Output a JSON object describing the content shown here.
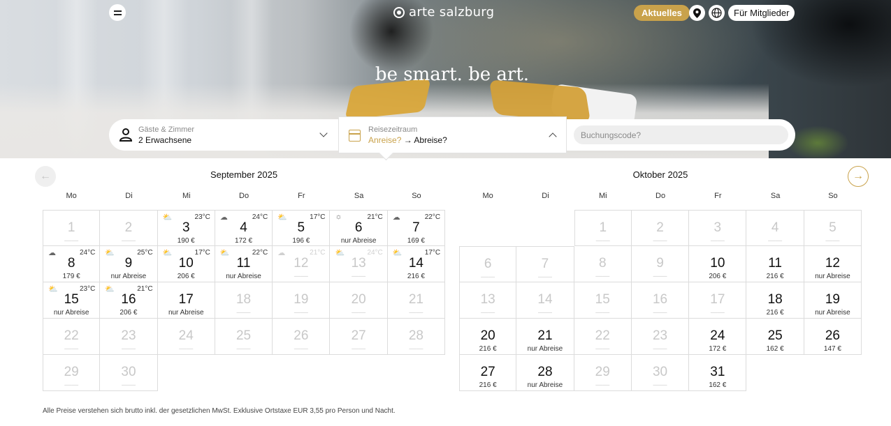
{
  "header": {
    "brand": "arte salzburg",
    "aktuelles_label": "Aktuelles",
    "members_label": "Für Mitglieder",
    "tagline": "be smart. be art."
  },
  "search": {
    "guests_label": "Gäste & Zimmer",
    "guests_value": "2 Erwachsene",
    "dates_label": "Reisezeitraum",
    "arrival": "Anreise?",
    "arrow": "→",
    "departure": "Abreise?",
    "code_placeholder": "Buchungscode?"
  },
  "colors": {
    "accent": "#c9a24b"
  },
  "weekdays": [
    "Mo",
    "Di",
    "Mi",
    "Do",
    "Fr",
    "Sa",
    "So"
  ],
  "months": [
    {
      "title": "September 2025",
      "offset": 0,
      "days": [
        {
          "d": "1",
          "p": "——",
          "dis": true
        },
        {
          "d": "2",
          "p": "——",
          "dis": true
        },
        {
          "d": "3",
          "p": "190 €",
          "w": "partly-cloudy",
          "t": "23°C"
        },
        {
          "d": "4",
          "p": "172 €",
          "w": "cloudy",
          "t": "24°C"
        },
        {
          "d": "5",
          "p": "196 €",
          "w": "partly-cloudy",
          "t": "17°C"
        },
        {
          "d": "6",
          "p": "nur Abreise",
          "w": "sunny",
          "t": "21°C"
        },
        {
          "d": "7",
          "p": "169 €",
          "w": "cloudy",
          "t": "22°C"
        },
        {
          "d": "8",
          "p": "179 €",
          "w": "cloudy",
          "t": "24°C"
        },
        {
          "d": "9",
          "p": "nur Abreise",
          "w": "partly-cloudy",
          "t": "25°C"
        },
        {
          "d": "10",
          "p": "206 €",
          "w": "partly-cloudy",
          "t": "17°C"
        },
        {
          "d": "11",
          "p": "nur Abreise",
          "w": "partly-cloudy",
          "t": "22°C"
        },
        {
          "d": "12",
          "p": "——",
          "w": "cloudy",
          "t": "21°C",
          "dis": true
        },
        {
          "d": "13",
          "p": "——",
          "w": "partly-cloudy",
          "t": "24°C",
          "dis": true
        },
        {
          "d": "14",
          "p": "216 €",
          "w": "partly-cloudy",
          "t": "17°C"
        },
        {
          "d": "15",
          "p": "nur Abreise",
          "w": "partly-cloudy",
          "t": "23°C"
        },
        {
          "d": "16",
          "p": "206 €",
          "w": "partly-cloudy",
          "t": "21°C"
        },
        {
          "d": "17",
          "p": "nur Abreise"
        },
        {
          "d": "18",
          "p": "——",
          "dis": true
        },
        {
          "d": "19",
          "p": "——",
          "dis": true
        },
        {
          "d": "20",
          "p": "——",
          "dis": true
        },
        {
          "d": "21",
          "p": "——",
          "dis": true
        },
        {
          "d": "22",
          "p": "——",
          "dis": true
        },
        {
          "d": "23",
          "p": "——",
          "dis": true
        },
        {
          "d": "24",
          "p": "——",
          "dis": true
        },
        {
          "d": "25",
          "p": "——",
          "dis": true
        },
        {
          "d": "26",
          "p": "——",
          "dis": true
        },
        {
          "d": "27",
          "p": "——",
          "dis": true
        },
        {
          "d": "28",
          "p": "——",
          "dis": true
        },
        {
          "d": "29",
          "p": "——",
          "dis": true
        },
        {
          "d": "30",
          "p": "——",
          "dis": true
        }
      ]
    },
    {
      "title": "Oktober 2025",
      "offset": 2,
      "days": [
        {
          "d": "1",
          "p": "——",
          "dis": true
        },
        {
          "d": "2",
          "p": "——",
          "dis": true
        },
        {
          "d": "3",
          "p": "——",
          "dis": true
        },
        {
          "d": "4",
          "p": "——",
          "dis": true
        },
        {
          "d": "5",
          "p": "——",
          "dis": true
        },
        {
          "d": "6",
          "p": "——",
          "dis": true
        },
        {
          "d": "7",
          "p": "——",
          "dis": true
        },
        {
          "d": "8",
          "p": "——",
          "dis": true
        },
        {
          "d": "9",
          "p": "——",
          "dis": true
        },
        {
          "d": "10",
          "p": "206 €"
        },
        {
          "d": "11",
          "p": "216 €"
        },
        {
          "d": "12",
          "p": "nur Abreise"
        },
        {
          "d": "13",
          "p": "——",
          "dis": true
        },
        {
          "d": "14",
          "p": "——",
          "dis": true
        },
        {
          "d": "15",
          "p": "——",
          "dis": true
        },
        {
          "d": "16",
          "p": "——",
          "dis": true
        },
        {
          "d": "17",
          "p": "——",
          "dis": true
        },
        {
          "d": "18",
          "p": "216 €"
        },
        {
          "d": "19",
          "p": "nur Abreise"
        },
        {
          "d": "20",
          "p": "216 €"
        },
        {
          "d": "21",
          "p": "nur Abreise"
        },
        {
          "d": "22",
          "p": "——",
          "dis": true
        },
        {
          "d": "23",
          "p": "——",
          "dis": true
        },
        {
          "d": "24",
          "p": "172 €"
        },
        {
          "d": "25",
          "p": "162 €"
        },
        {
          "d": "26",
          "p": "147 €"
        },
        {
          "d": "27",
          "p": "216 €"
        },
        {
          "d": "28",
          "p": "nur Abreise"
        },
        {
          "d": "29",
          "p": "——",
          "dis": true
        },
        {
          "d": "30",
          "p": "——",
          "dis": true
        },
        {
          "d": "31",
          "p": "162 €"
        }
      ]
    }
  ],
  "footer_note": "Alle Preise verstehen sich brutto inkl. der gesetzlichen MwSt. Exklusive  Ortstaxe EUR 3,55 pro Person und Nacht."
}
